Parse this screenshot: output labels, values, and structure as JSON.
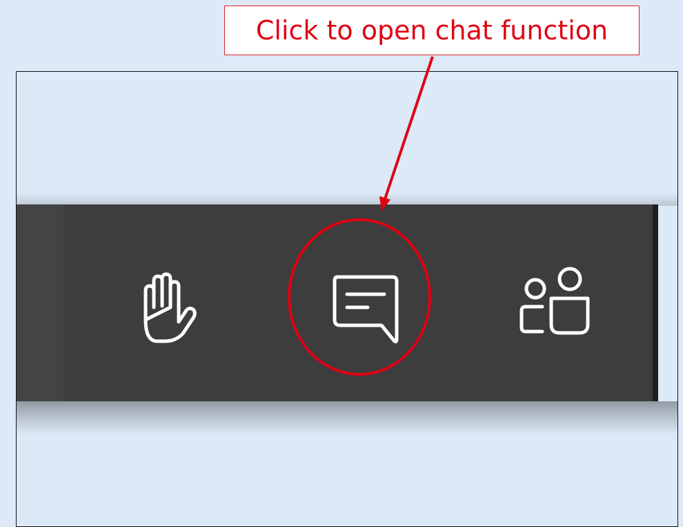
{
  "annotation": {
    "callout_text": "Click to open chat function",
    "color": "#e00012"
  },
  "toolbar": {
    "background": "#3d3d3d",
    "buttons": [
      {
        "id": "raise-hand",
        "icon": "hand-icon"
      },
      {
        "id": "chat",
        "icon": "chat-bubble-icon",
        "highlighted": true
      },
      {
        "id": "participants",
        "icon": "people-icon"
      }
    ]
  },
  "page_background": "#dde9f6"
}
